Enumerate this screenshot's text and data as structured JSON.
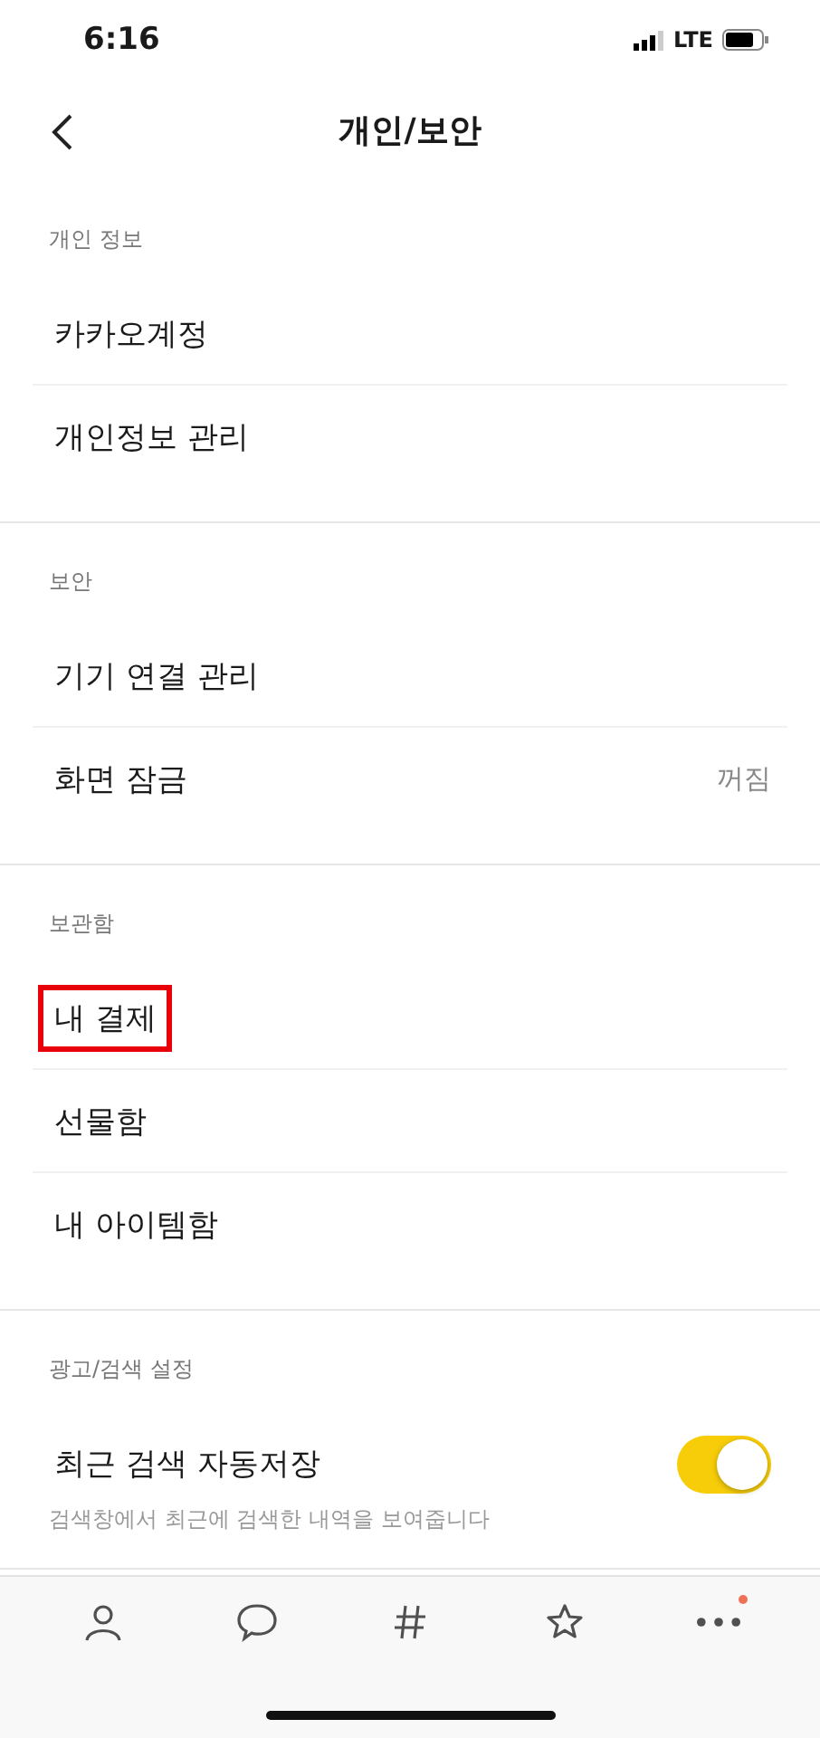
{
  "status_bar": {
    "time": "6:16",
    "network": "LTE"
  },
  "nav": {
    "title": "개인/보안"
  },
  "sections": [
    {
      "header": "개인 정보",
      "items": [
        {
          "kind": "link",
          "label": "카카오계정",
          "highlighted": false
        },
        {
          "kind": "link",
          "label": "개인정보 관리",
          "highlighted": false
        }
      ]
    },
    {
      "header": "보안",
      "items": [
        {
          "kind": "link",
          "label": "기기 연결 관리",
          "highlighted": false
        },
        {
          "kind": "value",
          "label": "화면 잠금",
          "value": "꺼짐",
          "highlighted": false
        }
      ]
    },
    {
      "header": "보관함",
      "items": [
        {
          "kind": "link",
          "label": "내 결제",
          "highlighted": true
        },
        {
          "kind": "link",
          "label": "선물함",
          "highlighted": false
        },
        {
          "kind": "link",
          "label": "내 아이템함",
          "highlighted": false
        }
      ]
    },
    {
      "header": "광고/검색 설정",
      "items": [
        {
          "kind": "toggle",
          "label": "최근 검색 자동저장",
          "on": true,
          "description": "검색창에서 최근에 검색한 내역을 보여줍니다",
          "highlighted": false
        }
      ]
    }
  ],
  "tab_bar": [
    {
      "kind": "friends",
      "selected": false,
      "dot": false
    },
    {
      "kind": "chats",
      "selected": false,
      "dot": false
    },
    {
      "kind": "hashtag",
      "selected": false,
      "dot": false
    },
    {
      "kind": "star",
      "selected": false,
      "dot": false
    },
    {
      "kind": "more",
      "selected": false,
      "dot": true
    }
  ]
}
